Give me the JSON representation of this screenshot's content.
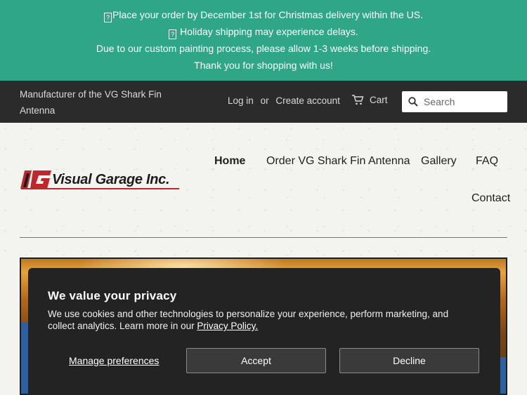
{
  "announcement": {
    "line1": "Place your order by December 1st for Christmas delivery within the US.",
    "line2": "Holiday shipping may experience delays.",
    "line3": "Due to our custom painting process, please allow 1-3 weeks before shipping.",
    "line4": "Thank you for shopping with us!"
  },
  "topbar": {
    "tagline": "Manufacturer of the VG Shark Fin Antenna",
    "login": "Log in",
    "or": "or",
    "create_account": "Create account",
    "cart": "Cart",
    "search_placeholder": "Search"
  },
  "logo": {
    "text": "Visual Garage Inc."
  },
  "nav": {
    "home": "Home",
    "order": "Order VG Shark Fin Antenna",
    "gallery": "Gallery",
    "faq": "FAQ",
    "contact": "Contact"
  },
  "cookie": {
    "title": "We value your privacy",
    "body": "We use cookies and other technologies to personalize your experience, perform marketing, and collect analytics. Learn more in our ",
    "policy_link": "Privacy Policy.",
    "manage": "Manage preferences",
    "accept": "Accept",
    "decline": "Decline"
  },
  "colors": {
    "announcement_bg": "#2fa688",
    "topbar_bg": "#2b2b2b",
    "cookie_bg": "#232323",
    "logo_red": "#c0272d"
  }
}
